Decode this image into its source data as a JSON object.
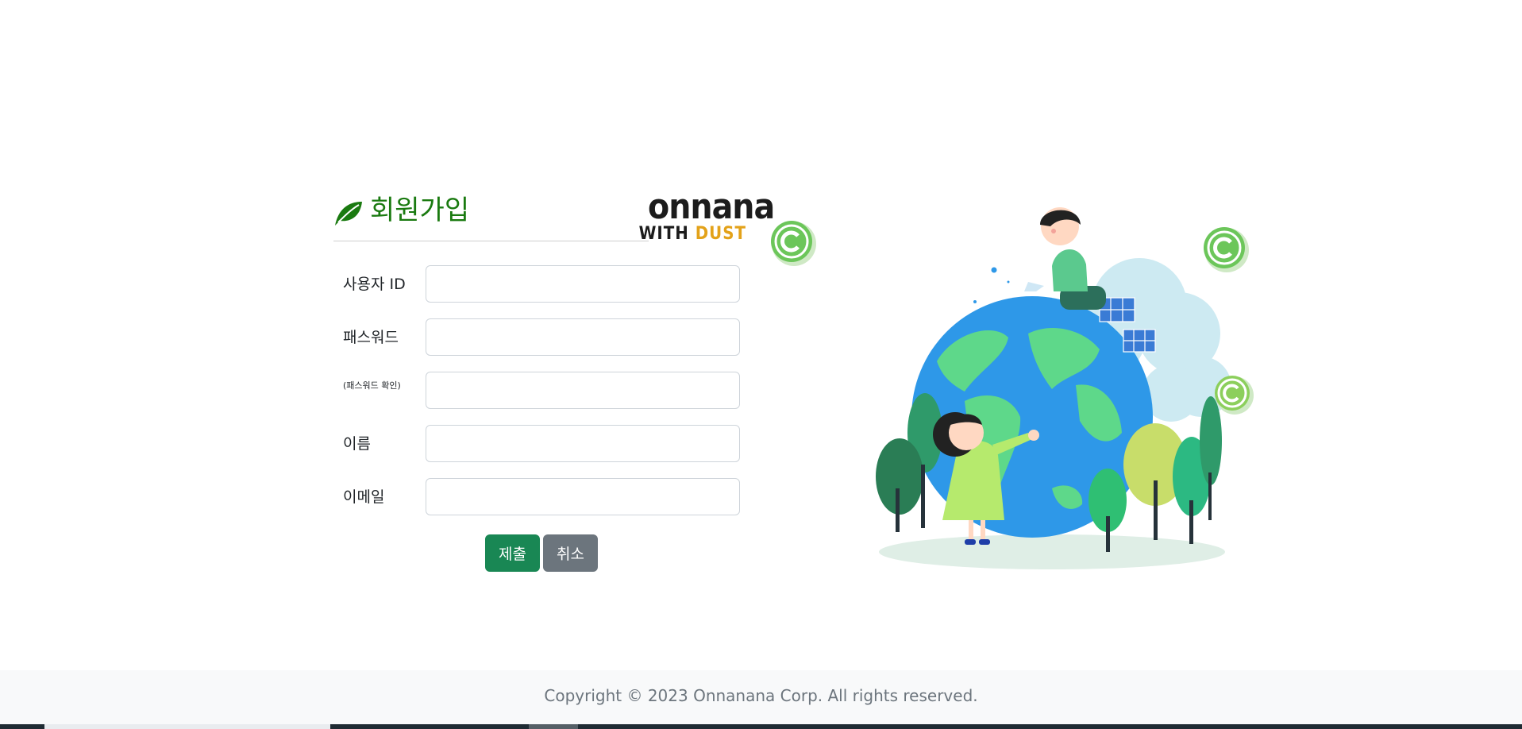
{
  "header": {
    "title": "회원가입",
    "logo_line1": "onnana",
    "logo_with": "WITH",
    "logo_dust": "DUST"
  },
  "form": {
    "fields": [
      {
        "label": "사용자 ID",
        "value": ""
      },
      {
        "label": "패스워드",
        "value": ""
      },
      {
        "label": "(패스워드 확인)",
        "value": ""
      },
      {
        "label": "이름",
        "value": ""
      },
      {
        "label": "이메일",
        "value": ""
      }
    ],
    "submit_label": "제출",
    "cancel_label": "취소"
  },
  "colors": {
    "title": "#1a7a10",
    "submit": "#198754",
    "cancel": "#6c757d",
    "logo_dust": "#e3a21a"
  },
  "footer": {
    "copyright": "Copyright © 2023 Onnanana Corp. All rights reserved."
  }
}
